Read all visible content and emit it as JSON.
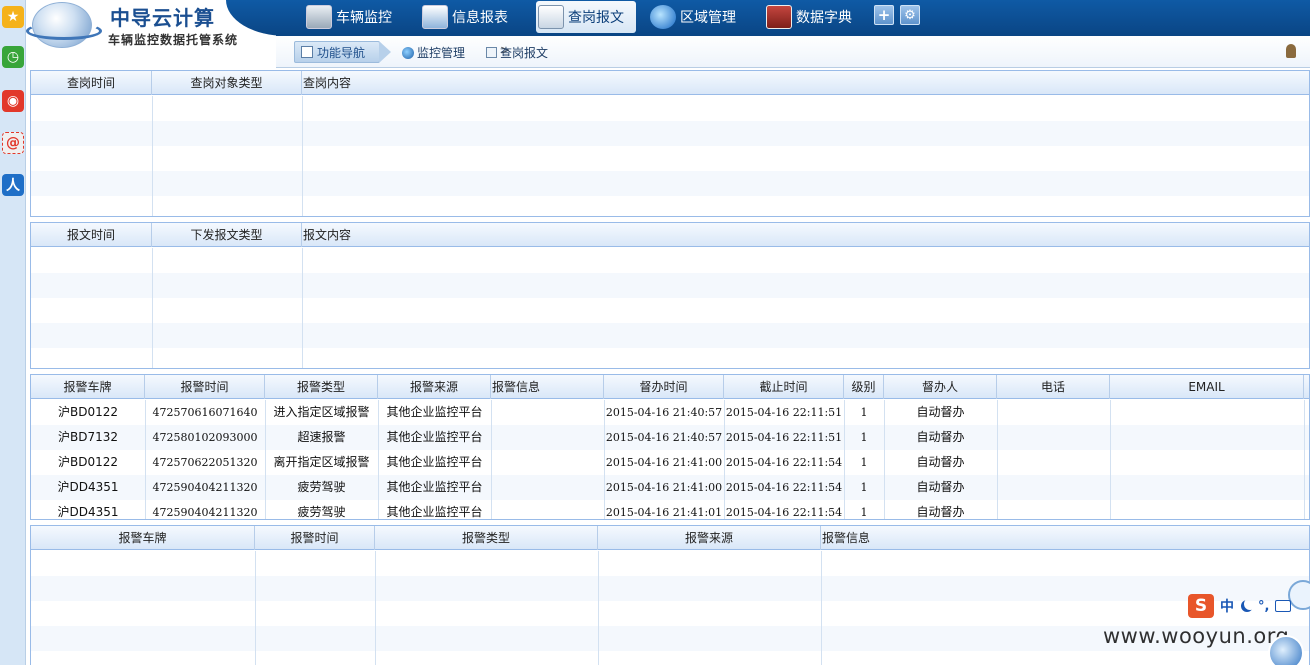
{
  "app": {
    "logo_title": "中导云计算",
    "logo_subtitle": "车辆监控数据托管系统"
  },
  "nav": {
    "items": [
      {
        "label": "车辆监控",
        "icon": "monitor-chart-icon"
      },
      {
        "label": "信息报表",
        "icon": "report-window-icon"
      },
      {
        "label": "查岗报文",
        "icon": "search-document-icon"
      },
      {
        "label": "区域管理",
        "icon": "globe-map-icon"
      },
      {
        "label": "数据字典",
        "icon": "dictionary-book-icon"
      }
    ],
    "active_index": 2,
    "add_glyph": "+",
    "settings_glyph": "⚙"
  },
  "breadcrumb": {
    "nav_label": "功能导航",
    "level1": "监控管理",
    "separator": ">",
    "level2": "查岗报文"
  },
  "grid_inspection": {
    "headers": [
      "查岗时间",
      "查岗对象类型",
      "查岗内容"
    ]
  },
  "grid_messages": {
    "headers": [
      "报文时间",
      "下发报文类型",
      "报文内容"
    ]
  },
  "grid_alarms": {
    "headers": [
      "报警车牌",
      "报警时间",
      "报警类型",
      "报警来源",
      "报警信息",
      "督办时间",
      "截止时间",
      "级别",
      "督办人",
      "电话",
      "EMAIL"
    ],
    "rows": [
      [
        "沪BD0122",
        "472570616071640",
        "进入指定区域报警",
        "其他企业监控平台",
        "",
        "2015-04-16 21:40:57",
        "2015-04-16 22:11:51",
        "1",
        "自动督办",
        "",
        ""
      ],
      [
        "沪BD7132",
        "472580102093000",
        "超速报警",
        "其他企业监控平台",
        "",
        "2015-04-16 21:40:57",
        "2015-04-16 22:11:51",
        "1",
        "自动督办",
        "",
        ""
      ],
      [
        "沪BD0122",
        "472570622051320",
        "离开指定区域报警",
        "其他企业监控平台",
        "",
        "2015-04-16 21:41:00",
        "2015-04-16 22:11:54",
        "1",
        "自动督办",
        "",
        ""
      ],
      [
        "沪DD4351",
        "472590404211320",
        "疲劳驾驶",
        "其他企业监控平台",
        "",
        "2015-04-16 21:41:00",
        "2015-04-16 22:11:54",
        "1",
        "自动督办",
        "",
        ""
      ],
      [
        "沪DD4351",
        "472590404211320",
        "疲劳驾驶",
        "其他企业监控平台",
        "",
        "2015-04-16 21:41:01",
        "2015-04-16 22:11:54",
        "1",
        "自动督办",
        "",
        ""
      ]
    ]
  },
  "grid_alarm_detail": {
    "headers": [
      "报警车牌",
      "报警时间",
      "报警类型",
      "报警来源",
      "报警信息"
    ]
  },
  "ime": {
    "logo": "S",
    "mode": "中",
    "punct": "°,"
  },
  "watermark": "www.wooyun.org",
  "colors": {
    "header_blue": "#0c4e96",
    "grid_border": "#99bbe8",
    "grid_header": "#d9e7f8"
  }
}
